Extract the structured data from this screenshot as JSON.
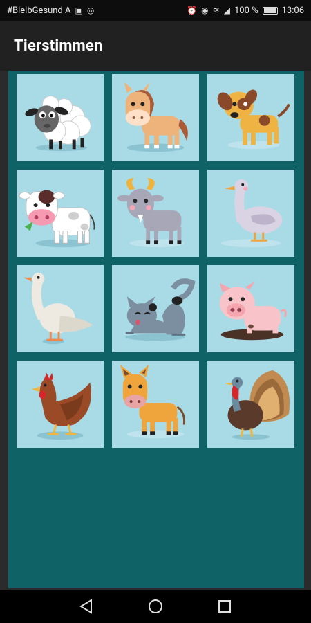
{
  "status_bar": {
    "notification_text": "#BleibGesund A",
    "battery": "100 %",
    "time": "13:06"
  },
  "app_bar": {
    "title": "Tierstimmen"
  },
  "animals": [
    {
      "icon": "sheep-icon"
    },
    {
      "icon": "horse-icon"
    },
    {
      "icon": "dog-icon"
    },
    {
      "icon": "cow-icon"
    },
    {
      "icon": "goat-icon"
    },
    {
      "icon": "duck-icon"
    },
    {
      "icon": "goose-icon"
    },
    {
      "icon": "cat-icon"
    },
    {
      "icon": "pig-icon"
    },
    {
      "icon": "chicken-icon"
    },
    {
      "icon": "donkey-icon"
    },
    {
      "icon": "turkey-icon"
    }
  ],
  "nav_bar": {
    "back": "back-icon",
    "home": "home-icon",
    "recents": "recents-icon"
  },
  "colors": {
    "tile_bg": "#a9dbe6",
    "grid_bg": "#0f6265",
    "app_bar": "#212121"
  }
}
